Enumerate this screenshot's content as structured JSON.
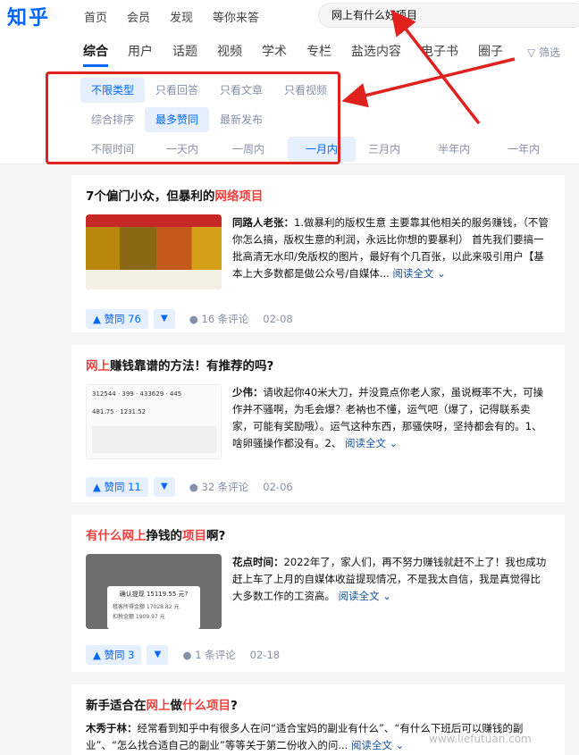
{
  "header": {
    "logo": "知乎",
    "nav": [
      "首页",
      "会员",
      "发现",
      "等你来答"
    ],
    "search_value": "网上有什么好项目"
  },
  "tabs": [
    "综合",
    "用户",
    "话题",
    "视频",
    "学术",
    "专栏",
    "盐选内容",
    "电子书",
    "圈子"
  ],
  "filter_label": "筛选",
  "filters": {
    "type": [
      "不限类型",
      "只看回答",
      "只看文章",
      "只看视频"
    ],
    "sort": [
      "综合排序",
      "最多赞同",
      "最新发布"
    ],
    "time": [
      "不限时间",
      "一天内",
      "一周内",
      "一月内",
      "三月内",
      "半年内",
      "一年内"
    ]
  },
  "cards": [
    {
      "title_pre": "7个偏门小众，但暴利的",
      "title_hl": "网络项目",
      "title_post": "",
      "author": "同路人老张：",
      "excerpt": "1.做暴利的版权生意 主要靠其他相关的服务赚钱，（不管你怎么搞，版权生意的利润，永远比你想的要暴利） 首先我们要搞一批高清无水印/免版权的图片，最好有个几百张，以此来吸引用户【基本上大多数都是做公众号/自媒体...",
      "readmore": "阅读全文 ⌄",
      "vote": "▲ 赞同 76",
      "comments": "16 条评论",
      "date": "02-08"
    },
    {
      "title_pre": "",
      "title_hl": "网上",
      "title_post": "赚钱靠谱的方法！有推荐的吗?",
      "author": "少伟：",
      "excerpt": "请收起你40米大刀，并没竟点你老人家，虽说概率不大，可操作并不骚啊，为毛会爆？老衲也不懂，运气吧（爆了，记得联系卖家，可能有奖励哦）。运气这种东西，那骚侠呀，坚持都会有的。1、啥卵骚操作都没有。2、",
      "readmore": "阅读全文 ⌄",
      "vote": "▲ 赞同 11",
      "comments": "32 条评论",
      "date": "02-06"
    },
    {
      "title_pre": "有什么",
      "title_hl": "网上",
      "title_mid": "挣钱的",
      "title_hl2": "项目",
      "title_post": "啊?",
      "author": "花点时间：",
      "excerpt": "2022年了，家人们，再不努力赚钱就赶不上了！我也成功赶上车了上月的自媒体收益提现情况，不是我太自信，我是真觉得比大多数工作的工资高。",
      "readmore": "阅读全文 ⌄",
      "vote": "▲ 赞同 3",
      "comments": "1 条评论",
      "date": "02-18",
      "thumb_text": "确认提现 15119.55 元?",
      "thumb_rows": [
        "租客所得金额 17028.82 元",
        "扣税金额 1909.97 元"
      ]
    },
    {
      "title_pre": "新手适合在",
      "title_hl": "网上",
      "title_mid": "做",
      "title_hl2": "什么项目",
      "title_post": "?",
      "author": "木秀于林：",
      "excerpt": "经常看到知乎中有很多人在问“适合宝妈的副业有什么”、“有什么下班后可以赚钱的副业”、“怎么找合适自己的副业”等等关于第二份收入的问...",
      "readmore": "阅读全文 ⌄"
    }
  ],
  "watermark": "www.liefutuan.com"
}
